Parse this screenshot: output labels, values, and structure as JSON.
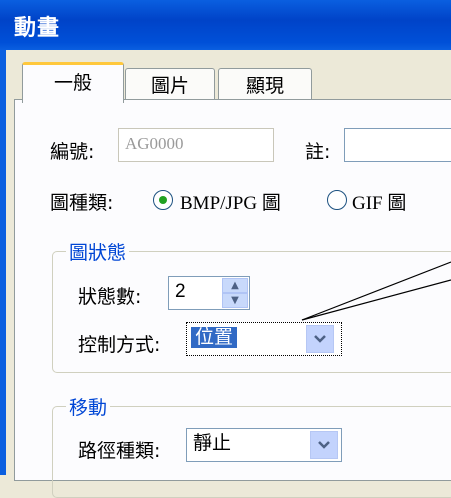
{
  "window": {
    "title": "動畫"
  },
  "tabs": [
    {
      "label": "一般"
    },
    {
      "label": "圖片"
    },
    {
      "label": "顯現"
    }
  ],
  "general": {
    "id_label": "編號:",
    "id_value": "AG0000",
    "note_label": "註:",
    "note_value": "",
    "image_type_label": "圖種類:",
    "image_type_options": [
      "BMP/JPG 圖",
      "GIF 圖"
    ],
    "image_type_selected": "BMP/JPG 圖"
  },
  "state_group": {
    "title": "圖狀態",
    "count_label": "狀態數:",
    "count_value": "2",
    "control_label": "控制方式:",
    "control_value": "位置"
  },
  "move_group": {
    "title": "移動",
    "path_label": "路徑種類:",
    "path_value": "靜止"
  }
}
